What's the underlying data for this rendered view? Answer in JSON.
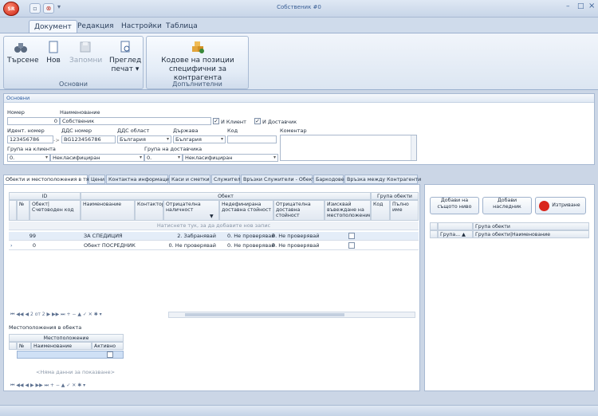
{
  "window": {
    "title": "Собственик #0"
  },
  "ribbon": {
    "tabs": [
      "Документ",
      "Редакция",
      "Настройки",
      "Таблица"
    ],
    "groups": {
      "main": "Основни",
      "extra": "Допълнителни"
    },
    "buttons": {
      "search": "Търсене",
      "new": "Нов",
      "save": "Запомни",
      "preview1": "Преглед",
      "preview2": "печат",
      "codes1": "Кодове на позиции",
      "codes2": "специфични за контрагента"
    }
  },
  "form": {
    "header": "Основни",
    "number_label": "Номер",
    "number_value": "0",
    "name_label": "Наименование",
    "name_value": "Собственик",
    "client_label": "И Клиент",
    "supplier_label": "И Доставчик",
    "id_label": "Идент. номер",
    "id_value": "123456786",
    "vat_label": "ДДС номер",
    "vat_value": "BG123456786",
    "vatarea_label": "ДДС област",
    "vatarea_value": "България",
    "country_label": "Държава",
    "country_value": "България",
    "code_label": "Код",
    "comment_label": "Коментар",
    "clientgroup_label": "Група на клиента",
    "clientgroup_code": "0.",
    "clientgroup_value": "Некласифициран",
    "suppliergroup_label": "Група на доставчика",
    "suppliergroup_code": "0.",
    "suppliergroup_value": "Некласифициран",
    "arrow": "->"
  },
  "doctabs": [
    "Обекти и местоположения в тях",
    "Цени",
    "Контактна информация",
    "Каси и сметки",
    "Служители",
    "Връзки Служители - Обекти",
    "Баркодове",
    "Връзка между Контрагенти"
  ],
  "grid": {
    "band_id": "ID",
    "band_object": "Обект",
    "band_group": "Група обекти",
    "cols": [
      "№",
      "Обект|Счетоводен код",
      "Наименование",
      "Контактор",
      "Отрицателна наличност",
      "Недефинирана доставна стойност",
      "Отрицателна доставна стойност",
      "Изисквай въвеждане на местоположение",
      "Код",
      "Пълно име"
    ],
    "newrow": "Натиснете тук, за да добавите нов запис",
    "rows": [
      {
        "num": "99",
        "name": "ЗА СПЕДИЦИЯ",
        "neg": "2. Забранявай",
        "undef": "0. Не проверявай",
        "negcost": "0. Не проверявай"
      },
      {
        "num": "0",
        "name": "Обект ПОСРЕДНИК",
        "neg": "0. Не проверявай",
        "undef": "0. Не проверявай",
        "negcost": "0. Не проверявай"
      }
    ],
    "nav": "2 от 2"
  },
  "locations": {
    "title": "Местоположения в обекта",
    "band": "Местоположение",
    "cols": [
      "№",
      "Наименование",
      "Активно"
    ],
    "empty": "<Няма данни за показване>"
  },
  "right": {
    "btn_same": "Добави на същото ниво",
    "btn_child": "Добави наследник",
    "btn_delete": "Изтриване",
    "col": "Група обекти",
    "row_a": "Група...",
    "row_b": "Група обекти|Наименование"
  },
  "colors": {
    "accent": "#2e5da0",
    "delete": "#d9261c"
  }
}
